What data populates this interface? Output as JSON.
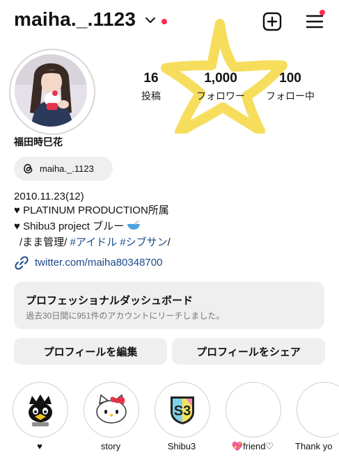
{
  "header": {
    "username": "maiha._.1123",
    "dropdown_icon": "chevron-down-icon",
    "status_dot_color": "#ff2d55",
    "create_icon": "plus-square-icon",
    "menu_icon": "hamburger-menu-icon"
  },
  "stats": [
    {
      "value": "16",
      "label": "投稿"
    },
    {
      "value": "1,000",
      "label": "フォロワー"
    },
    {
      "value": "100",
      "label": "フォロー中"
    }
  ],
  "profile": {
    "name": "福田時巳花",
    "threads_handle": "maiha._.1123",
    "bio_line1": "2010.11.23(12)",
    "bio_line2": "PLATINUM PRODUCTION所属",
    "bio_line3": "Shibu3 project  ブルー",
    "bio_line4_prefix": "/まま管理/ ",
    "bio_tag1": "#アイドル",
    "bio_tag2": "#シブサン",
    "bio_line4_suffix": "/",
    "link": "twitter.com/maiha80348700"
  },
  "dashboard": {
    "title": "プロフェッショナルダッシュボード",
    "subtitle": "過去30日間に951件のアカウントにリーチしました。"
  },
  "buttons": {
    "edit": "プロフィールを編集",
    "share": "プロフィールをシェア"
  },
  "highlights": [
    {
      "label": "♥",
      "icon": "badtz-maru-icon"
    },
    {
      "label": "story",
      "icon": "hello-kitty-icon"
    },
    {
      "label": "Shibu3",
      "icon": "shibu3-logo-icon"
    },
    {
      "label": "💖friend♡",
      "icon": ""
    },
    {
      "label": "Thank yo",
      "icon": ""
    }
  ],
  "accent_link_color": "#1a4a8c"
}
